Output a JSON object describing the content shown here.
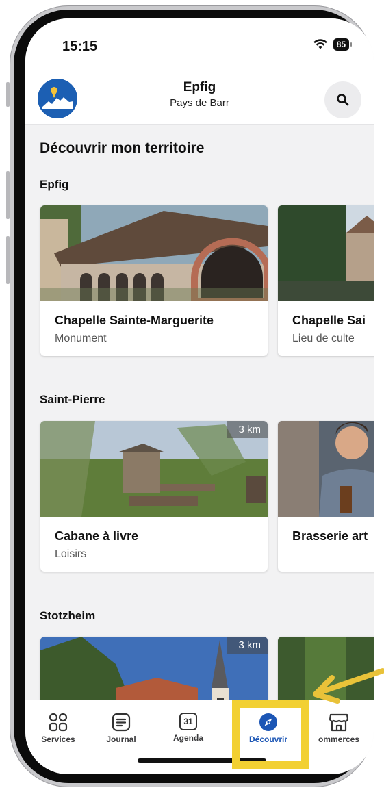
{
  "status_bar": {
    "time": "15:15",
    "battery": "85"
  },
  "header": {
    "title": "Epfig",
    "subtitle": "Pays de Barr"
  },
  "page_title": "Découvrir mon territoire",
  "sections": [
    {
      "title": "Epfig",
      "cards": [
        {
          "title": "Chapelle Sainte-Marguerite",
          "category": "Monument",
          "distance": ""
        },
        {
          "title": "Chapelle Sai",
          "category": "Lieu de culte",
          "distance": ""
        }
      ]
    },
    {
      "title": "Saint-Pierre",
      "cards": [
        {
          "title": "Cabane à livre",
          "category": "Loisirs",
          "distance": "3 km"
        },
        {
          "title": "Brasserie art",
          "category": "",
          "distance": ""
        }
      ]
    },
    {
      "title": "Stotzheim",
      "cards": [
        {
          "title": "",
          "category": "",
          "distance": "3 km"
        },
        {
          "title": "",
          "category": "",
          "distance": ""
        }
      ]
    }
  ],
  "tabs": [
    {
      "label": "Services",
      "icon": "grid-icon",
      "active": false
    },
    {
      "label": "Journal",
      "icon": "journal-icon",
      "active": false
    },
    {
      "label": "Agenda",
      "icon": "calendar-icon",
      "calendar_day": "31",
      "active": false
    },
    {
      "label": "Découvrir",
      "icon": "compass-icon",
      "active": true
    },
    {
      "label": "ommerces",
      "icon": "storefront-icon",
      "active": false
    }
  ],
  "colors": {
    "accent": "#1c56b5",
    "highlight": "#f2d033",
    "arrow": "#e9c239"
  }
}
